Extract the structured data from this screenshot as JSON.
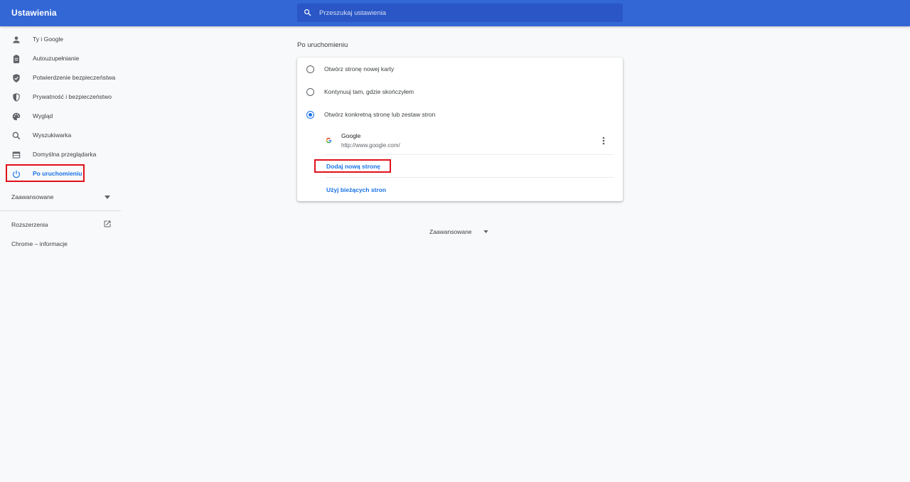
{
  "app_title": "Ustawienia",
  "search": {
    "placeholder": "Przeszukaj ustawienia"
  },
  "sidebar": {
    "items": [
      {
        "label": "Ty i Google",
        "icon": "person-icon"
      },
      {
        "label": "Autouzupełnianie",
        "icon": "clipboard-icon"
      },
      {
        "label": "Potwierdzenie bezpieczeństwa",
        "icon": "shield-check-icon"
      },
      {
        "label": "Prywatność i bezpieczeństwo",
        "icon": "shield-icon"
      },
      {
        "label": "Wygląd",
        "icon": "palette-icon"
      },
      {
        "label": "Wyszukiwarka",
        "icon": "search-icon"
      },
      {
        "label": "Domyślna przeglądarka",
        "icon": "browser-icon"
      },
      {
        "label": "Po uruchomieniu",
        "icon": "power-icon",
        "active": true
      }
    ],
    "advanced": "Zaawansowane",
    "extensions": "Rozszerzenia",
    "about": "Chrome – informacje"
  },
  "main": {
    "section_title": "Po uruchomieniu",
    "options": [
      {
        "label": "Otwórz stronę nowej karty",
        "checked": false
      },
      {
        "label": "Kontynuuj tam, gdzie skończyłem",
        "checked": false
      },
      {
        "label": "Otwórz konkretną stronę lub zestaw stron",
        "checked": true
      }
    ],
    "site": {
      "name": "Google",
      "url": "http://www.google.com/"
    },
    "add_page": "Dodaj nową stronę",
    "use_current": "Użyj bieżących stron",
    "advanced": "Zaawansowane"
  },
  "colors": {
    "header": "#3367d6",
    "accent": "#1a73e8",
    "highlight": "#e0101a"
  }
}
